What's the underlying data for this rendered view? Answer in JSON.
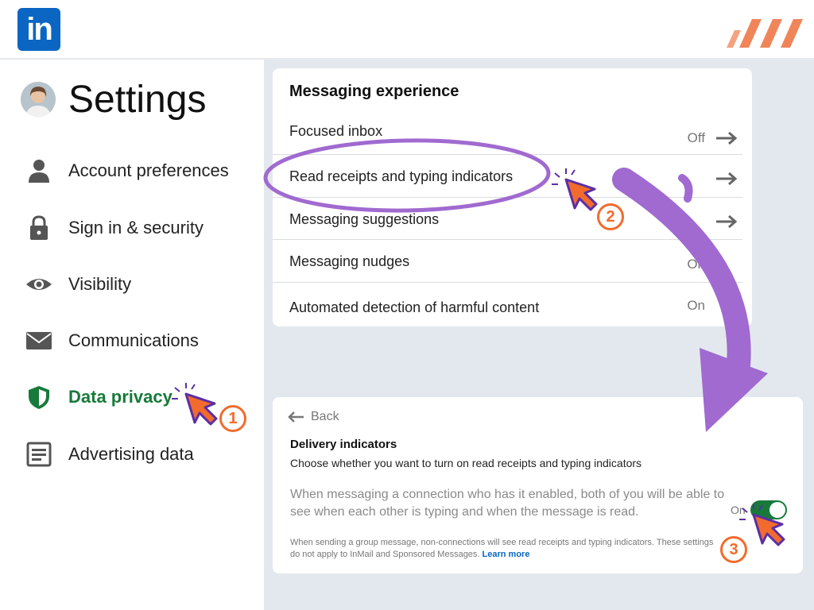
{
  "header": {
    "logo_text": "in"
  },
  "sidebar": {
    "title": "Settings",
    "items": [
      {
        "label": "Account preferences",
        "icon": "person-icon"
      },
      {
        "label": "Sign in & security",
        "icon": "lock-icon"
      },
      {
        "label": "Visibility",
        "icon": "eye-icon"
      },
      {
        "label": "Communications",
        "icon": "envelope-icon"
      },
      {
        "label": "Data privacy",
        "icon": "shield-icon"
      },
      {
        "label": "Advertising data",
        "icon": "document-icon"
      }
    ]
  },
  "messaging": {
    "title": "Messaging experience",
    "rows": [
      {
        "label": "Focused inbox",
        "value": "Off"
      },
      {
        "label": "Read receipts and typing indicators",
        "value": ""
      },
      {
        "label": "Messaging suggestions",
        "value": ""
      },
      {
        "label": "Messaging nudges",
        "value": "On"
      },
      {
        "label": "Automated detection of harmful content",
        "value": "On"
      }
    ]
  },
  "detail": {
    "back_label": "Back",
    "title": "Delivery indicators",
    "subtitle": "Choose whether you want to turn on read receipts and typing indicators",
    "description": "When messaging a connection who has it enabled, both of you will be able to see when each other is typing and when the message is read.",
    "toggle_label": "On",
    "note": "When sending a group message, non-connections will see read receipts and typing indicators. These settings do not apply to InMail and Sponsored Messages.",
    "learn_more": "Learn more"
  },
  "steps": [
    "1",
    "2",
    "3"
  ],
  "colors": {
    "brand_blue": "#0a66c2",
    "active_green": "#177a3a",
    "annotation_orange": "#f26b2d",
    "annotation_purple": "#a06ad0"
  }
}
